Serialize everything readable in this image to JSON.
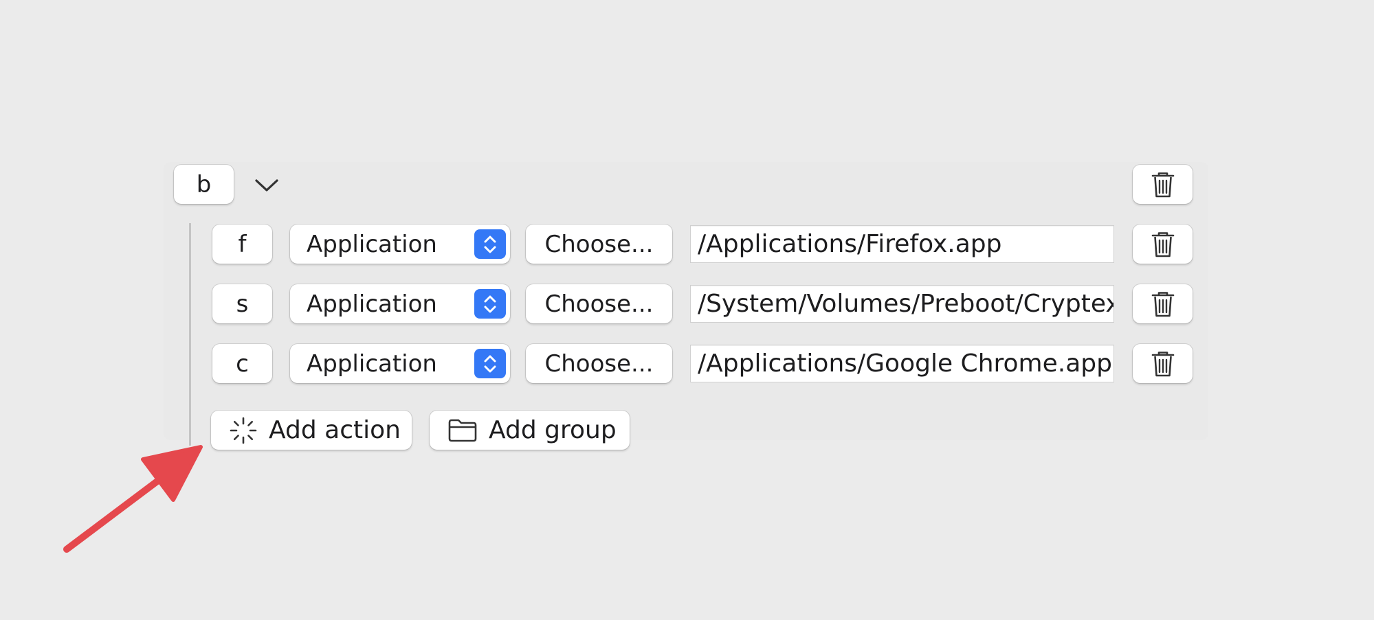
{
  "group": {
    "key": "b",
    "expanded_icon": "chevron-down-icon",
    "delete_icon": "trash-icon"
  },
  "actions": [
    {
      "key": "f",
      "type": "Application",
      "choose_label": "Choose...",
      "path": "/Applications/Firefox.app"
    },
    {
      "key": "s",
      "type": "Application",
      "choose_label": "Choose...",
      "path": "/System/Volumes/Preboot/Cryptex"
    },
    {
      "key": "c",
      "type": "Application",
      "choose_label": "Choose...",
      "path": "/Applications/Google Chrome.app"
    }
  ],
  "footer": {
    "add_action_label": "Add action",
    "add_action_icon": "sparkle-icon",
    "add_group_label": "Add group",
    "add_group_icon": "folder-icon"
  },
  "annotation": {
    "arrow_color": "#e5484d",
    "arrow_icon": "arrow-icon"
  },
  "colors": {
    "accent": "#3478f6",
    "background": "#ebebeb"
  }
}
